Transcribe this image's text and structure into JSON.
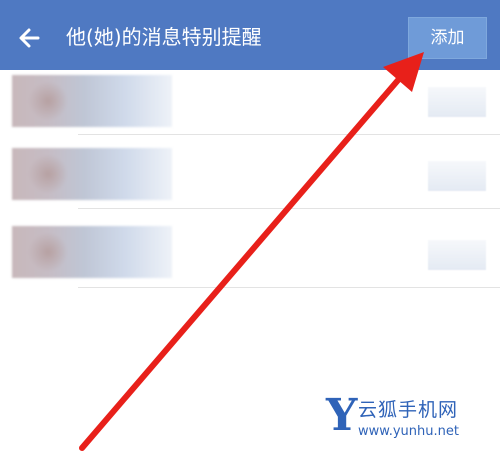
{
  "header": {
    "title": "他(她)的消息特别提醒",
    "add_label": "添加"
  },
  "list": {
    "rows": [
      {
        "blurred": true
      },
      {
        "blurred": true
      },
      {
        "blurred": true
      }
    ]
  },
  "annotation": {
    "arrow_color": "#e8201a"
  },
  "watermark": {
    "letter": "Y",
    "name": "云狐手机网",
    "url": "www.yunhu.net",
    "color": "#2f63b8"
  },
  "colors": {
    "header_bg": "#4f79c2",
    "add_button_bg": "#6f9bd8"
  }
}
